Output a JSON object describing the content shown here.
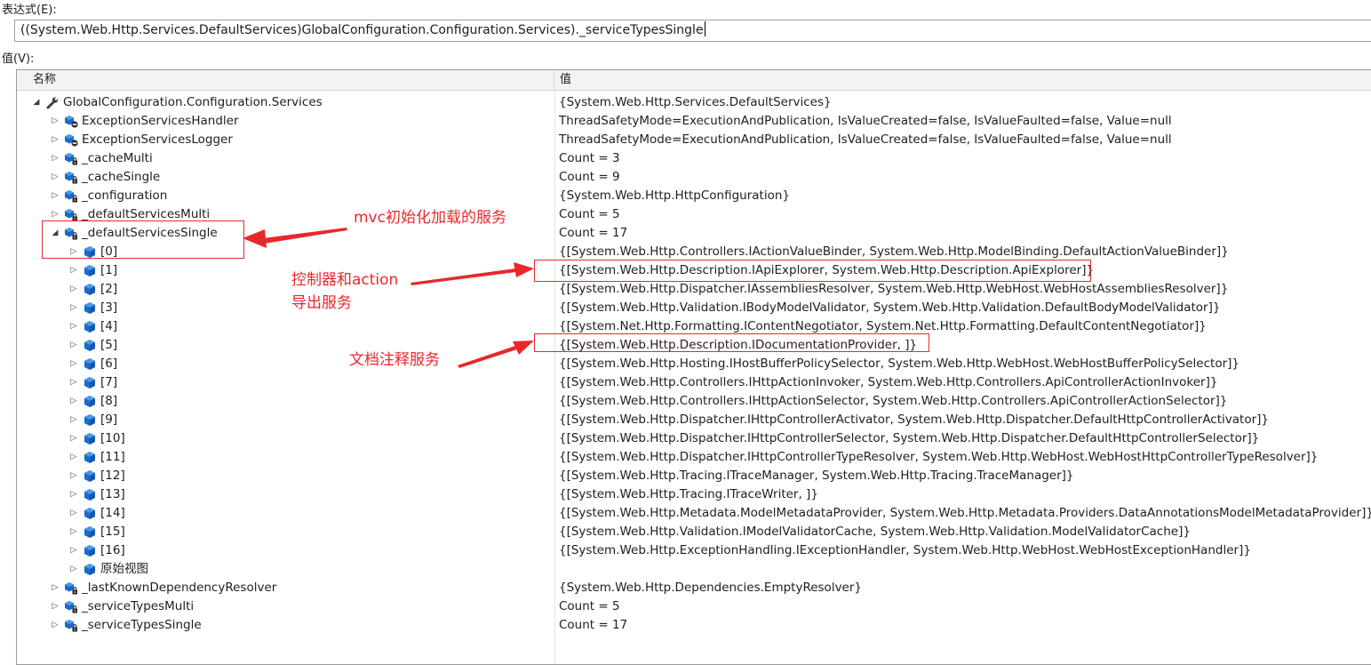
{
  "expression": {
    "label": "表达式(E):",
    "value": "((System.Web.Http.Services.DefaultServices)GlobalConfiguration.Configuration.Services)._serviceTypesSingle"
  },
  "value_label": "值(V):",
  "grid": {
    "headers": {
      "name": "名称",
      "value": "值"
    },
    "rows": [
      {
        "name": "GlobalConfiguration.Configuration.Services",
        "value": "{System.Web.Http.Services.DefaultServices}",
        "level": 0,
        "expanded": true,
        "icon": "wrench-icon"
      },
      {
        "name": "ExceptionServicesHandler",
        "value": "ThreadSafetyMode=ExecutionAndPublication, IsValueCreated=false, IsValueFaulted=false, Value=null",
        "level": 1,
        "expanded": false,
        "icon": "private-field-icon"
      },
      {
        "name": "ExceptionServicesLogger",
        "value": "ThreadSafetyMode=ExecutionAndPublication, IsValueCreated=false, IsValueFaulted=false, Value=null",
        "level": 1,
        "expanded": false,
        "icon": "private-field-icon"
      },
      {
        "name": "_cacheMulti",
        "value": "Count = 3",
        "level": 1,
        "expanded": false,
        "icon": "private-lock-field-icon"
      },
      {
        "name": "_cacheSingle",
        "value": "Count = 9",
        "level": 1,
        "expanded": false,
        "icon": "private-lock-field-icon"
      },
      {
        "name": "_configuration",
        "value": "{System.Web.Http.HttpConfiguration}",
        "level": 1,
        "expanded": false,
        "icon": "private-lock-field-icon"
      },
      {
        "name": "_defaultServicesMulti",
        "value": "Count = 5",
        "level": 1,
        "expanded": false,
        "icon": "private-lock-field-icon"
      },
      {
        "name": "_defaultServicesSingle",
        "value": "Count = 17",
        "level": 1,
        "expanded": true,
        "icon": "private-lock-field-icon"
      },
      {
        "name": "[0]",
        "value": "{[System.Web.Http.Controllers.IActionValueBinder, System.Web.Http.ModelBinding.DefaultActionValueBinder]}",
        "level": 2,
        "expanded": false,
        "icon": "object-icon"
      },
      {
        "name": "[1]",
        "value": "{[System.Web.Http.Description.IApiExplorer, System.Web.Http.Description.ApiExplorer]}",
        "level": 2,
        "expanded": false,
        "icon": "object-icon"
      },
      {
        "name": "[2]",
        "value": "{[System.Web.Http.Dispatcher.IAssembliesResolver, System.Web.Http.WebHost.WebHostAssembliesResolver]}",
        "level": 2,
        "expanded": false,
        "icon": "object-icon"
      },
      {
        "name": "[3]",
        "value": "{[System.Web.Http.Validation.IBodyModelValidator, System.Web.Http.Validation.DefaultBodyModelValidator]}",
        "level": 2,
        "expanded": false,
        "icon": "object-icon"
      },
      {
        "name": "[4]",
        "value": "{[System.Net.Http.Formatting.IContentNegotiator, System.Net.Http.Formatting.DefaultContentNegotiator]}",
        "level": 2,
        "expanded": false,
        "icon": "object-icon"
      },
      {
        "name": "[5]",
        "value": "{[System.Web.Http.Description.IDocumentationProvider, ]}",
        "level": 2,
        "expanded": false,
        "icon": "object-icon"
      },
      {
        "name": "[6]",
        "value": "{[System.Web.Http.Hosting.IHostBufferPolicySelector, System.Web.Http.WebHost.WebHostBufferPolicySelector]}",
        "level": 2,
        "expanded": false,
        "icon": "object-icon"
      },
      {
        "name": "[7]",
        "value": "{[System.Web.Http.Controllers.IHttpActionInvoker, System.Web.Http.Controllers.ApiControllerActionInvoker]}",
        "level": 2,
        "expanded": false,
        "icon": "object-icon"
      },
      {
        "name": "[8]",
        "value": "{[System.Web.Http.Controllers.IHttpActionSelector, System.Web.Http.Controllers.ApiControllerActionSelector]}",
        "level": 2,
        "expanded": false,
        "icon": "object-icon"
      },
      {
        "name": "[9]",
        "value": "{[System.Web.Http.Dispatcher.IHttpControllerActivator, System.Web.Http.Dispatcher.DefaultHttpControllerActivator]}",
        "level": 2,
        "expanded": false,
        "icon": "object-icon"
      },
      {
        "name": "[10]",
        "value": "{[System.Web.Http.Dispatcher.IHttpControllerSelector, System.Web.Http.Dispatcher.DefaultHttpControllerSelector]}",
        "level": 2,
        "expanded": false,
        "icon": "object-icon"
      },
      {
        "name": "[11]",
        "value": "{[System.Web.Http.Dispatcher.IHttpControllerTypeResolver, System.Web.Http.WebHost.WebHostHttpControllerTypeResolver]}",
        "level": 2,
        "expanded": false,
        "icon": "object-icon"
      },
      {
        "name": "[12]",
        "value": "{[System.Web.Http.Tracing.ITraceManager, System.Web.Http.Tracing.TraceManager]}",
        "level": 2,
        "expanded": false,
        "icon": "object-icon"
      },
      {
        "name": "[13]",
        "value": "{[System.Web.Http.Tracing.ITraceWriter, ]}",
        "level": 2,
        "expanded": false,
        "icon": "object-icon"
      },
      {
        "name": "[14]",
        "value": "{[System.Web.Http.Metadata.ModelMetadataProvider, System.Web.Http.Metadata.Providers.DataAnnotationsModelMetadataProvider]}",
        "level": 2,
        "expanded": false,
        "icon": "object-icon"
      },
      {
        "name": "[15]",
        "value": "{[System.Web.Http.Validation.IModelValidatorCache, System.Web.Http.Validation.ModelValidatorCache]}",
        "level": 2,
        "expanded": false,
        "icon": "object-icon"
      },
      {
        "name": "[16]",
        "value": "{[System.Web.Http.ExceptionHandling.IExceptionHandler, System.Web.Http.WebHost.WebHostExceptionHandler]}",
        "level": 2,
        "expanded": false,
        "icon": "object-icon"
      },
      {
        "name": "原始视图",
        "value": "",
        "level": 2,
        "expanded": false,
        "icon": "object-icon"
      },
      {
        "name": "_lastKnownDependencyResolver",
        "value": "{System.Web.Http.Dependencies.EmptyResolver}",
        "level": 1,
        "expanded": false,
        "icon": "private-lock-field-icon"
      },
      {
        "name": "_serviceTypesMulti",
        "value": "Count = 5",
        "level": 1,
        "expanded": false,
        "icon": "private-lock-field-icon"
      },
      {
        "name": "_serviceTypesSingle",
        "value": "Count = 17",
        "level": 1,
        "expanded": false,
        "icon": "private-lock-field-icon"
      }
    ]
  },
  "annotations": {
    "mvc_init": "mvc初始化加载的服务",
    "controller_line1": "控制器和action",
    "controller_line2": "导出服务",
    "doc": "文档注释服务",
    "color": "#e8282b"
  }
}
